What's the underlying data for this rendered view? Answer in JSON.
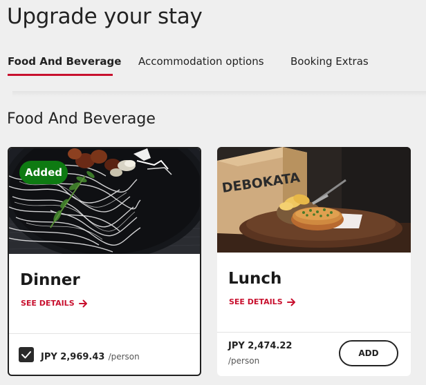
{
  "page": {
    "title": "Upgrade your stay"
  },
  "tabs": [
    {
      "label": "Food And Beverage",
      "active": true
    },
    {
      "label": "Accommodation options",
      "active": false
    },
    {
      "label": "Booking Extras",
      "active": false
    }
  ],
  "section": {
    "title": "Food And Beverage"
  },
  "cards": [
    {
      "name": "Dinner",
      "badge": "Added",
      "selected": true,
      "see_details": "SEE DETAILS",
      "price": "JPY 2,969.43",
      "unit": "/person",
      "image": "plate-of-noodles-photo"
    },
    {
      "name": "Lunch",
      "selected": false,
      "see_details": "SEE DETAILS",
      "price": "JPY 2,474.22",
      "unit": "/person",
      "add_label": "ADD",
      "image": "debokata-bread-photo",
      "image_text": "DEBOKATA"
    }
  ],
  "colors": {
    "accent": "#c8102e",
    "badge": "#0e7a12",
    "background": "#efefef"
  }
}
